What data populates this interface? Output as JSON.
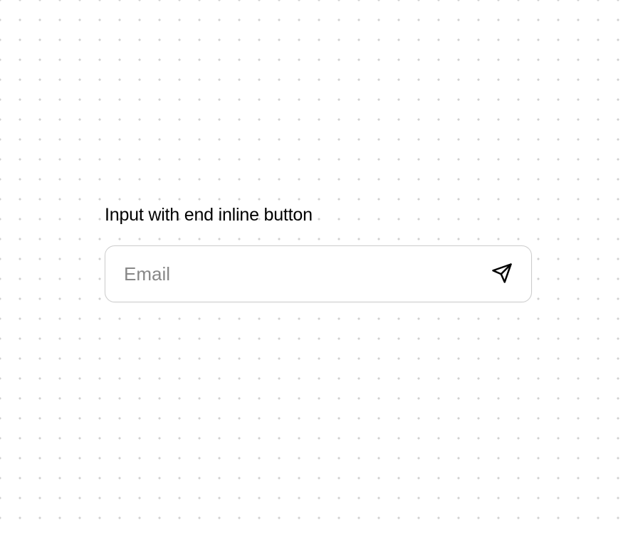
{
  "component": {
    "label": "Input with end inline button",
    "input": {
      "placeholder": "Email",
      "value": ""
    },
    "button": {
      "icon": "send-icon"
    }
  }
}
